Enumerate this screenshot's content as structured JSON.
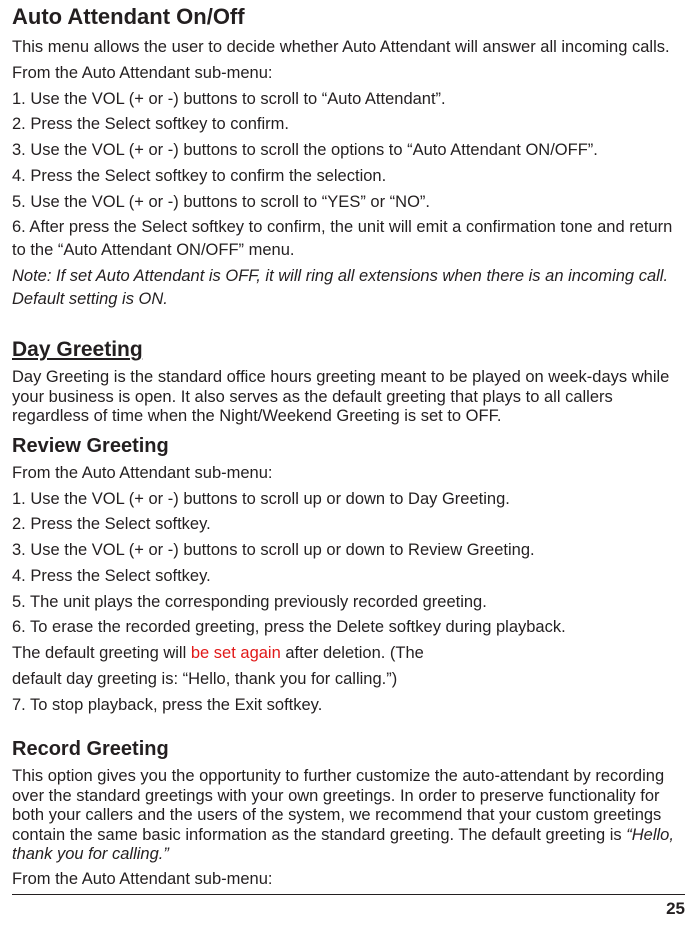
{
  "section1": {
    "title": "Auto Attendant On/Off",
    "intro": "This menu allows the user to decide whether Auto Attendant will answer all incoming calls.",
    "lead": "From the Auto Attendant sub-menu:",
    "steps": [
      "1. Use the VOL (+ or -) buttons to scroll to “Auto Attendant”.",
      "2. Press the Select softkey to confirm.",
      "3. Use the VOL (+ or -) buttons to scroll the options to “Auto Attendant ON/OFF”.",
      "4. Press the Select softkey to confirm the selection.",
      "5. Use the VOL (+ or -) buttons to scroll to “YES” or “NO”.",
      "6. After press the Select softkey to confirm, the unit will emit a confirmation tone and return to the “Auto Attendant ON/OFF” menu."
    ],
    "note": "Note: If set Auto Attendant is OFF, it will ring all extensions when there is an incoming call. Default setting is ON."
  },
  "section2": {
    "title": "Day Greeting",
    "desc": "Day Greeting is the standard office hours greeting meant to be played on week-days while your business is open.  It also serves as the default greeting that plays to all callers regardless of time when the Night/Weekend Greeting is set to OFF."
  },
  "section3": {
    "title": "Review Greeting",
    "lead": "From the Auto Attendant sub-menu:",
    "steps": [
      "1. Use the VOL (+ or -) buttons to scroll up or down to Day Greeting.",
      "2. Press the Select softkey.",
      "3. Use the VOL (+ or -) buttons to scroll up or down to Review Greeting.",
      "4. Press the Select softkey.",
      "5. The unit plays the corresponding previously recorded greeting.",
      "6. To erase the recorded greeting, press the Delete softkey during playback."
    ],
    "inline_pre": "The default greeting will ",
    "inline_red": "be set again",
    "inline_mid": "  after deletion.  (The",
    "inline_tail": "default day greeting is:  “Hello, thank you for calling.”)",
    "step7": "7. To stop playback, press the Exit softkey."
  },
  "section4": {
    "title": "Record Greeting",
    "para_start": "This option gives you the opportunity to further customize the auto-attendant by recording over the standard greetings with your own greetings.  In order to preserve functionality for both your callers and the users of the system, we recommend that your custom greetings contain the same basic information as the standard greeting.  The default greeting is ",
    "para_ital": "“Hello, thank you for calling.”",
    "lead": "From the Auto Attendant sub-menu:"
  },
  "page_number": "25"
}
